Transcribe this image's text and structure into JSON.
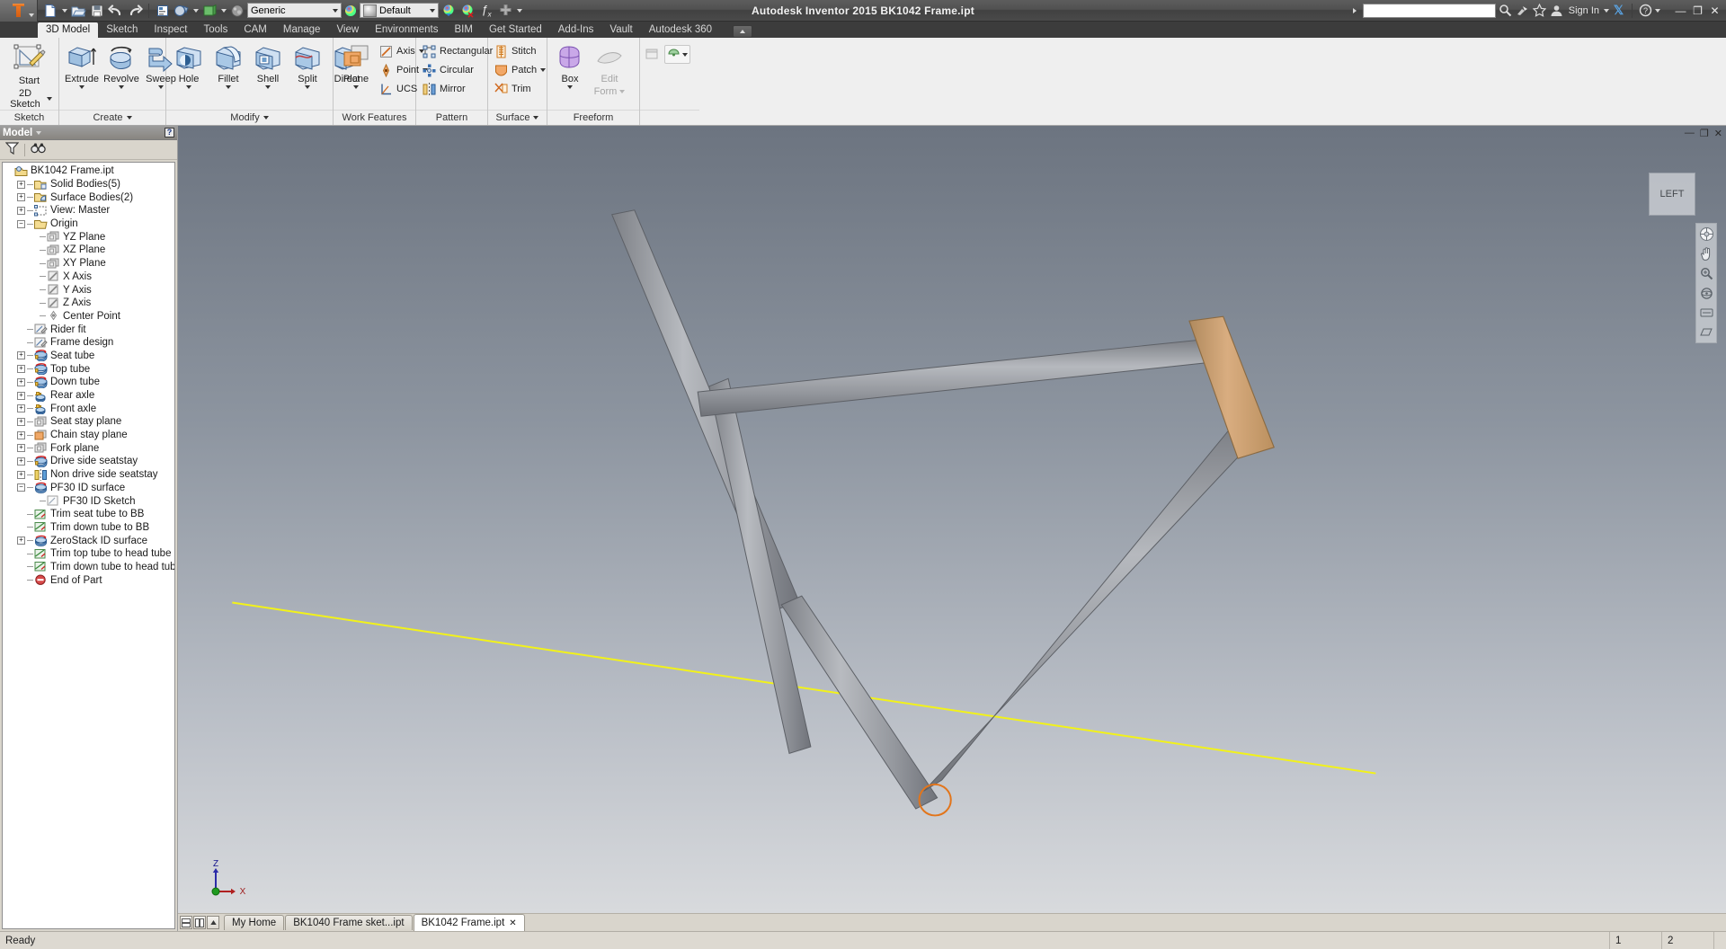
{
  "titlebar": {
    "app_icon": "inventor-logo-icon",
    "app_title": "Autodesk Inventor 2015   BK1042 Frame.ipt",
    "quick_access": [
      {
        "name": "new-file-button",
        "icon": "new-document-icon",
        "dropdown": true
      },
      {
        "name": "open-file-button",
        "icon": "open-folder-icon",
        "dropdown": false
      },
      {
        "name": "save-button",
        "icon": "floppy-disk-icon",
        "dropdown": false
      },
      {
        "name": "undo-button",
        "icon": "undo-arrow-icon",
        "dropdown": false
      },
      {
        "name": "redo-button",
        "icon": "redo-arrow-icon",
        "dropdown": false
      },
      {
        "name": "parameters-button",
        "icon": "parameters-icon",
        "dropdown": false
      },
      {
        "name": "material-browser-button",
        "icon": "material-sphere-icon",
        "dropdown": true
      },
      {
        "name": "appearance-browser-button",
        "icon": "appearance-box-icon",
        "dropdown": true
      },
      {
        "name": "render-button",
        "icon": "render-globe-icon",
        "dropdown": false
      }
    ],
    "material_value": "Generic",
    "appearance_value": "Default",
    "adjust_buttons": [
      {
        "name": "clear-appearance-override-button",
        "icon": "color-wheel-icon"
      },
      {
        "name": "adjust-appearance-button",
        "icon": "color-wheel-x-icon"
      },
      {
        "name": "fx-parameters-button",
        "icon": "fx-icon"
      },
      {
        "name": "customize-qat-button",
        "icon": "plus-icon"
      },
      {
        "name": "qat-dropdown",
        "icon": "chevron-down-icon"
      }
    ],
    "search_placeholder": "",
    "search_value": "",
    "right_items": [
      {
        "name": "search-button",
        "icon": "magnifier-icon",
        "label": ""
      },
      {
        "name": "autodesk-exchange-button",
        "icon": "satellite-dish-icon",
        "label": ""
      },
      {
        "name": "favorites-button",
        "icon": "star-icon",
        "label": ""
      },
      {
        "name": "sign-in-button",
        "icon": "person-icon",
        "label": "Sign In"
      },
      {
        "name": "exchange-apps-button",
        "icon": "x-logo-icon",
        "label": ""
      },
      {
        "name": "help-button",
        "icon": "question-circle-icon",
        "label": ""
      }
    ],
    "window_controls": [
      "minimize",
      "restore",
      "close"
    ]
  },
  "ribbon": {
    "tabs": [
      {
        "label": "3D Model",
        "active": true
      },
      {
        "label": "Sketch",
        "active": false
      },
      {
        "label": "Inspect",
        "active": false
      },
      {
        "label": "Tools",
        "active": false
      },
      {
        "label": "CAM",
        "active": false
      },
      {
        "label": "Manage",
        "active": false
      },
      {
        "label": "View",
        "active": false
      },
      {
        "label": "Environments",
        "active": false
      },
      {
        "label": "BIM",
        "active": false
      },
      {
        "label": "Get Started",
        "active": false
      },
      {
        "label": "Add-Ins",
        "active": false
      },
      {
        "label": "Vault",
        "active": false
      },
      {
        "label": "Autodesk 360",
        "active": false
      }
    ],
    "panels": [
      {
        "title": "Sketch",
        "has_dropdown": false,
        "big_buttons": [
          {
            "label": "Start\n2D Sketch",
            "label1": "Start",
            "label2": "2D Sketch",
            "icon": "start-2d-sketch-icon",
            "dropdown": true
          }
        ],
        "small_buttons": []
      },
      {
        "title": "Create",
        "has_dropdown": true,
        "big_buttons": [
          {
            "label1": "Extrude",
            "label2": "",
            "icon": "extrude-icon",
            "dropdown": true
          },
          {
            "label1": "Revolve",
            "label2": "",
            "icon": "revolve-icon",
            "dropdown": true
          },
          {
            "label1": "Sweep",
            "label2": "",
            "icon": "sweep-icon",
            "dropdown": true
          }
        ],
        "small_buttons": []
      },
      {
        "title": "Modify",
        "has_dropdown": true,
        "big_buttons": [
          {
            "label1": "Hole",
            "label2": "",
            "icon": "hole-icon",
            "dropdown": true
          },
          {
            "label1": "Fillet",
            "label2": "",
            "icon": "fillet-icon",
            "dropdown": true
          },
          {
            "label1": "Shell",
            "label2": "",
            "icon": "shell-icon",
            "dropdown": true
          },
          {
            "label1": "Split",
            "label2": "",
            "icon": "split-icon",
            "dropdown": true
          },
          {
            "label1": "Direct",
            "label2": "",
            "icon": "direct-edit-icon",
            "dropdown": false
          }
        ],
        "small_buttons": []
      },
      {
        "title": "Work Features",
        "has_dropdown": false,
        "big_buttons": [
          {
            "label1": "Plane",
            "label2": "",
            "icon": "work-plane-icon",
            "dropdown": true
          }
        ],
        "small_buttons": [
          {
            "label": "Axis",
            "icon": "work-axis-icon",
            "dropdown": true
          },
          {
            "label": "Point",
            "icon": "work-point-icon",
            "dropdown": true
          },
          {
            "label": "UCS",
            "icon": "ucs-icon",
            "dropdown": false
          }
        ]
      },
      {
        "title": "Pattern",
        "has_dropdown": false,
        "big_buttons": [],
        "small_buttons": [
          {
            "label": "Rectangular",
            "icon": "rectangular-pattern-icon",
            "dropdown": false
          },
          {
            "label": "Circular",
            "icon": "circular-pattern-icon",
            "dropdown": false
          },
          {
            "label": "Mirror",
            "icon": "mirror-icon",
            "dropdown": false
          }
        ]
      },
      {
        "title": "Surface",
        "has_dropdown": true,
        "big_buttons": [],
        "small_buttons": [
          {
            "label": "Stitch",
            "icon": "stitch-icon",
            "dropdown": false
          },
          {
            "label": "Patch",
            "icon": "patch-icon",
            "dropdown": true
          },
          {
            "label": "Trim",
            "icon": "trim-icon",
            "dropdown": false
          }
        ]
      },
      {
        "title": "Freeform",
        "has_dropdown": false,
        "big_buttons": [
          {
            "label1": "Box",
            "label2": "",
            "icon": "freeform-box-icon",
            "dropdown": true
          },
          {
            "label1": "Edit",
            "label2": "Form",
            "icon": "edit-form-icon",
            "dropdown": true,
            "disabled": true
          }
        ],
        "small_buttons": []
      }
    ],
    "overflow": [
      {
        "name": "ribbon-extra-button",
        "icon": "panel-extra-icon"
      },
      {
        "name": "appearance-dropdown-button",
        "icon": "appearance-dropdown-icon"
      }
    ]
  },
  "browser": {
    "header_title": "Model",
    "header_dropdown_icon": "chevron-down-icon",
    "help_icon": "help-marker-icon",
    "toolbar": [
      {
        "name": "filter-button",
        "icon": "filter-funnel-icon"
      },
      {
        "name": "find-button",
        "icon": "binoculars-icon"
      }
    ],
    "tree": [
      {
        "label": "BK1042 Frame.ipt",
        "depth": 0,
        "expander": "none",
        "icon": "part-document-icon"
      },
      {
        "label": "Solid Bodies(5)",
        "depth": 1,
        "expander": "plus",
        "icon": "solid-bodies-folder-icon"
      },
      {
        "label": "Surface Bodies(2)",
        "depth": 1,
        "expander": "plus",
        "icon": "surface-bodies-folder-icon"
      },
      {
        "label": "View: Master",
        "depth": 1,
        "expander": "plus",
        "icon": "view-master-icon"
      },
      {
        "label": "Origin",
        "depth": 1,
        "expander": "minus",
        "icon": "origin-folder-icon"
      },
      {
        "label": "YZ Plane",
        "depth": 2,
        "expander": "none",
        "icon": "work-plane-icon"
      },
      {
        "label": "XZ Plane",
        "depth": 2,
        "expander": "none",
        "icon": "work-plane-icon"
      },
      {
        "label": "XY Plane",
        "depth": 2,
        "expander": "none",
        "icon": "work-plane-icon"
      },
      {
        "label": "X Axis",
        "depth": 2,
        "expander": "none",
        "icon": "work-axis-icon"
      },
      {
        "label": "Y Axis",
        "depth": 2,
        "expander": "none",
        "icon": "work-axis-icon"
      },
      {
        "label": "Z Axis",
        "depth": 2,
        "expander": "none",
        "icon": "work-axis-icon"
      },
      {
        "label": "Center Point",
        "depth": 2,
        "expander": "none",
        "icon": "center-point-icon"
      },
      {
        "label": "Rider fit",
        "depth": 1,
        "expander": "none",
        "icon": "sketch-icon"
      },
      {
        "label": "Frame design",
        "depth": 1,
        "expander": "none",
        "icon": "sketch-icon"
      },
      {
        "label": "Seat tube",
        "depth": 1,
        "expander": "plus",
        "icon": "sweep-feature-icon"
      },
      {
        "label": "Top tube",
        "depth": 1,
        "expander": "plus",
        "icon": "sweep-feature-icon"
      },
      {
        "label": "Down tube",
        "depth": 1,
        "expander": "plus",
        "icon": "sweep-feature-icon"
      },
      {
        "label": "Rear axle",
        "depth": 1,
        "expander": "plus",
        "icon": "work-axis-feature-icon"
      },
      {
        "label": "Front axle",
        "depth": 1,
        "expander": "plus",
        "icon": "work-axis-feature-icon"
      },
      {
        "label": "Seat stay plane",
        "depth": 1,
        "expander": "plus",
        "icon": "work-plane-icon"
      },
      {
        "label": "Chain stay plane",
        "depth": 1,
        "expander": "plus",
        "icon": "work-plane-orange-icon"
      },
      {
        "label": "Fork plane",
        "depth": 1,
        "expander": "plus",
        "icon": "work-plane-icon"
      },
      {
        "label": "Drive side seatstay",
        "depth": 1,
        "expander": "plus",
        "icon": "sweep-feature-icon"
      },
      {
        "label": "Non drive side seatstay",
        "depth": 1,
        "expander": "plus",
        "icon": "mirror-feature-icon"
      },
      {
        "label": "PF30 ID surface",
        "depth": 1,
        "expander": "minus",
        "icon": "revolve-surface-icon"
      },
      {
        "label": "PF30 ID Sketch",
        "depth": 2,
        "expander": "none",
        "icon": "sketch-consumed-icon"
      },
      {
        "label": "Trim seat tube to BB",
        "depth": 1,
        "expander": "none",
        "icon": "trim-feature-icon"
      },
      {
        "label": "Trim down tube to BB",
        "depth": 1,
        "expander": "none",
        "icon": "trim-feature-icon"
      },
      {
        "label": "ZeroStack ID surface",
        "depth": 1,
        "expander": "plus",
        "icon": "revolve-surface-icon"
      },
      {
        "label": "Trim top tube to head tube",
        "depth": 1,
        "expander": "none",
        "icon": "trim-feature-icon"
      },
      {
        "label": "Trim down tube to head tube",
        "depth": 1,
        "expander": "none",
        "icon": "trim-feature-icon"
      },
      {
        "label": "End of Part",
        "depth": 1,
        "expander": "none",
        "icon": "end-of-part-icon"
      }
    ]
  },
  "canvas": {
    "viewcube_label": "LEFT",
    "window_controls": [
      "minimize",
      "restore",
      "close"
    ],
    "navbar_tools": [
      {
        "name": "full-navigation-wheel-icon"
      },
      {
        "name": "pan-hand-icon"
      },
      {
        "name": "zoom-magnifier-icon"
      },
      {
        "name": "orbit-icon"
      },
      {
        "name": "look-at-icon"
      },
      {
        "name": "display-style-icon"
      }
    ],
    "axis_labels": {
      "z": "Z",
      "x": "X"
    },
    "colors": {
      "tube_gray": "#9b9ea3",
      "head_tube_tan": "#cfa47a",
      "construction_yellow": "#f5f520",
      "bb_circle": "#e06a1a",
      "bg_top": "#6c7480",
      "bg_bottom": "#d8dadd"
    }
  },
  "doctabs": {
    "left_icons": [
      {
        "name": "tile-horizontal-button",
        "icon": "tile-h-icon"
      },
      {
        "name": "tile-vertical-button",
        "icon": "tile-v-icon"
      },
      {
        "name": "tab-scroll-button",
        "icon": "scroll-up-icon"
      }
    ],
    "tabs": [
      {
        "label": "My Home",
        "active": false,
        "closable": false
      },
      {
        "label": "BK1040 Frame sket...ipt",
        "active": false,
        "closable": false
      },
      {
        "label": "BK1042 Frame.ipt",
        "active": true,
        "closable": true
      }
    ]
  },
  "status": {
    "message": "Ready",
    "cells": [
      "1",
      "2"
    ]
  }
}
